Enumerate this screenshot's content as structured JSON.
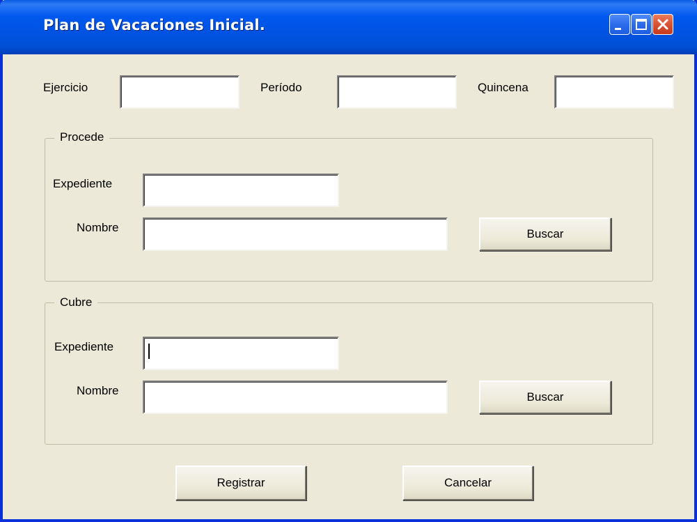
{
  "window": {
    "title": "Plan de Vacaciones Inicial.",
    "controls": {
      "minimize": "minimize-icon",
      "maximize": "maximize-icon",
      "close": "close-icon"
    }
  },
  "top_fields": {
    "ejercicio_label": "Ejercicio",
    "ejercicio_value": "",
    "periodo_label": "Período",
    "periodo_value": "",
    "quincena_label": "Quincena",
    "quincena_value": ""
  },
  "procede": {
    "legend": "Procede",
    "expediente_label": "Expediente",
    "expediente_value": "",
    "nombre_label": "Nombre",
    "nombre_value": "",
    "buscar_label": "Buscar"
  },
  "cubre": {
    "legend": "Cubre",
    "expediente_label": "Expediente",
    "expediente_value": "",
    "nombre_label": "Nombre",
    "nombre_value": "",
    "buscar_label": "Buscar"
  },
  "actions": {
    "registrar_label": "Registrar",
    "cancelar_label": "Cancelar"
  },
  "colors": {
    "titlebar": "#0054E3",
    "face": "#ECE9D8",
    "close_button": "#D95334"
  }
}
